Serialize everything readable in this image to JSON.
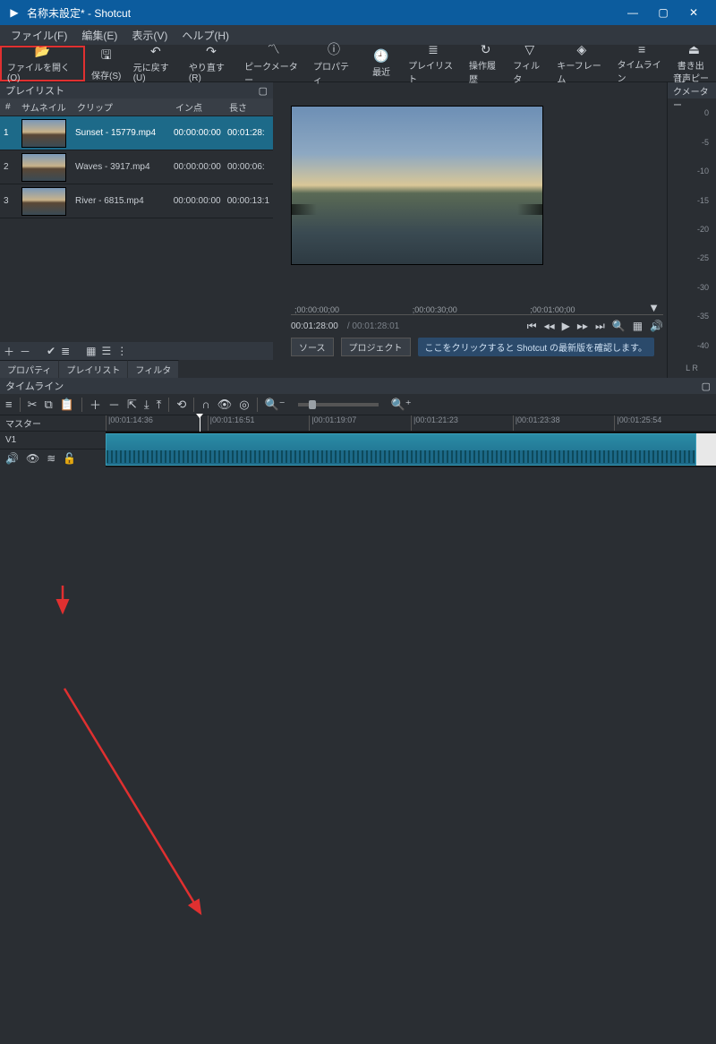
{
  "window_title": "名称未設定* - Shotcut",
  "menubar": [
    {
      "label": "ファイル(F)"
    },
    {
      "label": "編集(E)"
    },
    {
      "label": "表示(V)"
    },
    {
      "label": "ヘルプ(H)"
    }
  ],
  "toolbar": [
    {
      "label": "ファイルを開く(O)",
      "icon": "📂"
    },
    {
      "label": "保存(S)",
      "icon": "🖫"
    },
    {
      "label": "元に戻す(U)",
      "icon": "↶"
    },
    {
      "label": "やり直す(R)",
      "icon": "↷"
    },
    {
      "label": "ピークメーター",
      "icon": "〽"
    },
    {
      "label": "プロパティ",
      "icon": "ⓘ"
    },
    {
      "label": "最近",
      "icon": "🕘"
    },
    {
      "label": "プレイリスト",
      "icon": "≣"
    },
    {
      "label": "操作履歴",
      "icon": "↻"
    },
    {
      "label": "フィルタ",
      "icon": "▽"
    },
    {
      "label": "キーフレーム",
      "icon": "◈"
    },
    {
      "label": "タイムライン",
      "icon": "≡"
    },
    {
      "label": "書き出し",
      "icon": "⏏"
    }
  ],
  "playlist": {
    "title": "プレイリスト",
    "headers": {
      "index": "#",
      "thumb": "サムネイル",
      "clip": "クリップ",
      "in": "イン点",
      "len": "長さ"
    },
    "rows": [
      {
        "idx": "1",
        "clip": "Sunset - 15779.mp4",
        "in": "00:00:00:00",
        "len": "00:01:28:"
      },
      {
        "idx": "2",
        "clip": "Waves - 3917.mp4",
        "in": "00:00:00:00",
        "len": "00:00:06:"
      },
      {
        "idx": "3",
        "clip": "River - 6815.mp4",
        "in": "00:00:00:00",
        "len": "00:00:13:1"
      }
    ],
    "tabs": [
      "プロパティ",
      "プレイリスト",
      "フィルタ"
    ]
  },
  "preview": {
    "ruler": [
      ";00:00:00;00",
      ";00:00:30;00",
      ";00:01:00;00"
    ],
    "tc_current": "00:01:28:00",
    "tc_total": "/ 00:01:28:01",
    "source_btn": "ソース",
    "project_btn": "プロジェクト",
    "banner": "ここをクリックすると Shotcut の最新版を確認します。"
  },
  "meter": {
    "title": "音声ピークメーター",
    "ticks": [
      "0",
      "-5",
      "-10",
      "-15",
      "-20",
      "-25",
      "-30",
      "-35",
      "-40"
    ],
    "lr": "L  R"
  },
  "timeline": {
    "title": "タイムライン",
    "master_label": "マスター",
    "v1_label": "V1",
    "ruler": [
      "|00:01:14:36",
      "|00:01:16:51",
      "|00:01:19:07",
      "|00:01:21:23",
      "|00:01:23:38",
      "|00:01:25:54"
    ]
  }
}
